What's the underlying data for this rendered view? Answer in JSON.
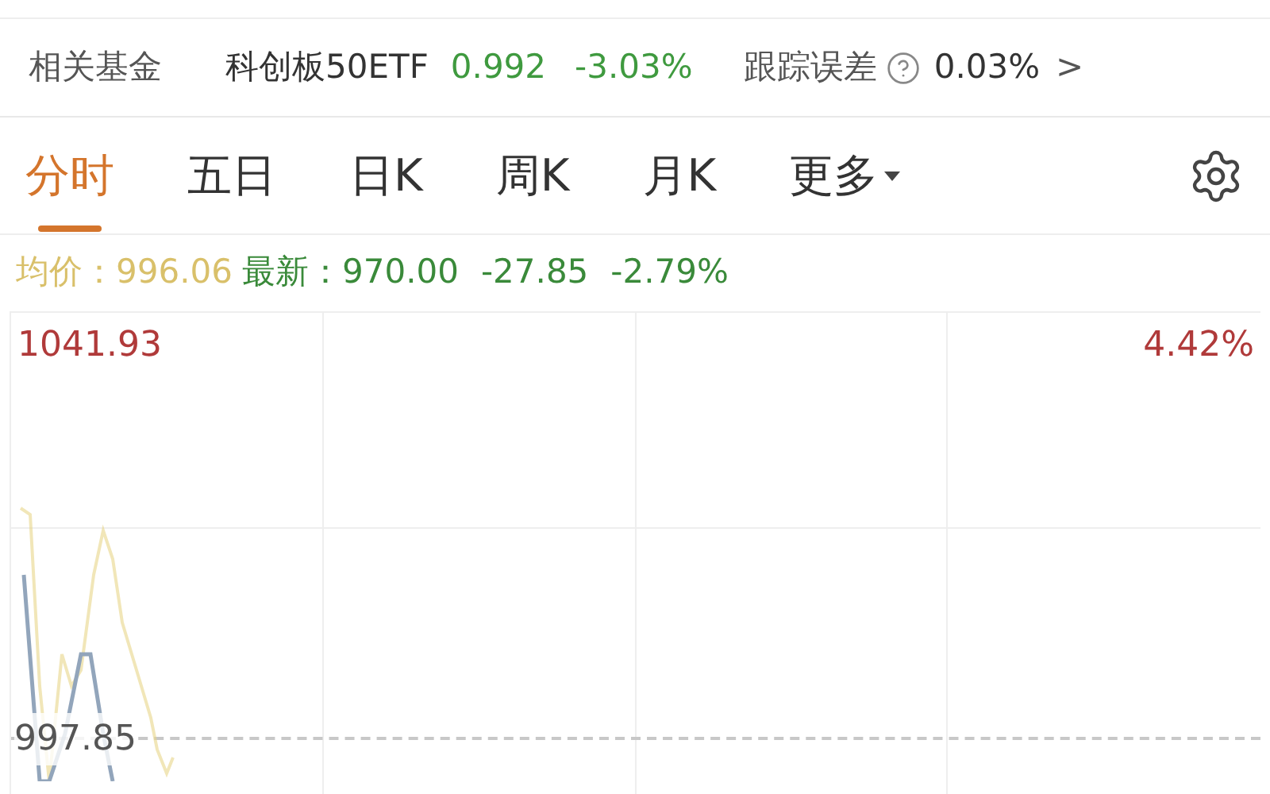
{
  "fund_bar": {
    "label": "相关基金",
    "fund_name": "科创板50ETF",
    "price": "0.992",
    "change": "-3.03%",
    "tracking_label": "跟踪误差",
    "tracking_value": "0.03%",
    "chevron": ">"
  },
  "tabs": [
    {
      "label": "分时",
      "selected": true,
      "kind": "tab"
    },
    {
      "label": "五日",
      "selected": false,
      "kind": "tab"
    },
    {
      "label": "日K",
      "selected": false,
      "kind": "tab"
    },
    {
      "label": "周K",
      "selected": false,
      "kind": "tab"
    },
    {
      "label": "月K",
      "selected": false,
      "kind": "tab"
    },
    {
      "label": "更多",
      "selected": false,
      "kind": "dropdown"
    }
  ],
  "quote": {
    "avg_label": "均价：",
    "avg_value": "996.06",
    "latest_label": "最新：",
    "latest_value": "970.00",
    "change": "-27.85",
    "change_pct": "-2.79%"
  },
  "chart": {
    "high": "1041.93",
    "high_pct": "4.42%",
    "prev_close": "997.85"
  }
}
